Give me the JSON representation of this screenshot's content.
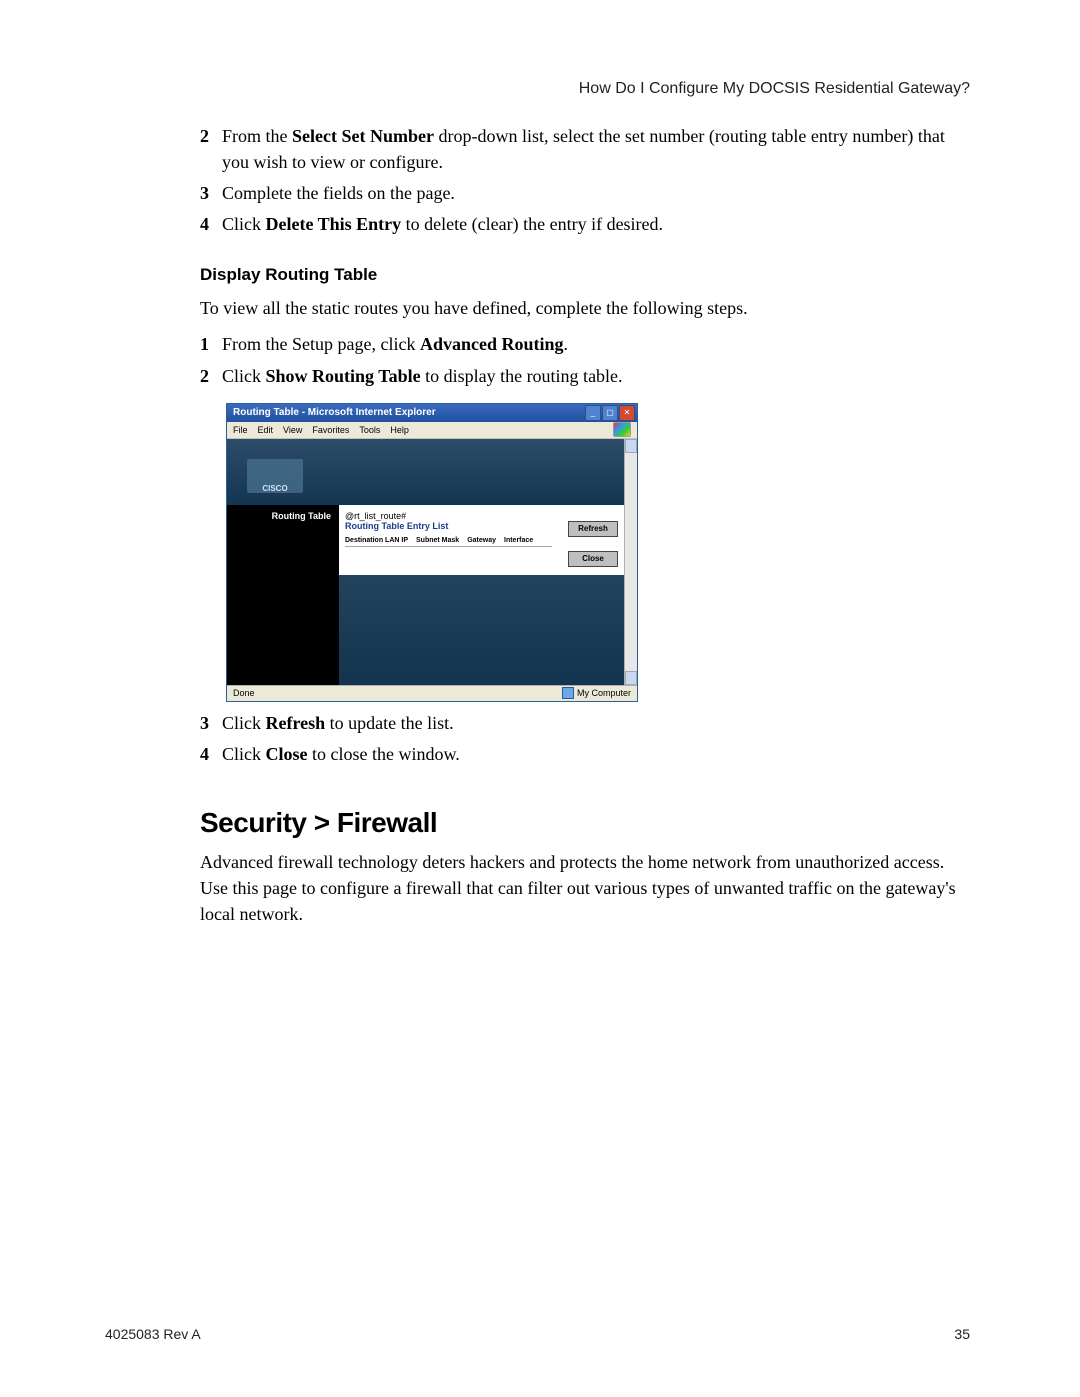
{
  "header": {
    "right_text": "How Do I Configure My DOCSIS Residential Gateway?"
  },
  "steps_a": [
    {
      "num": "2",
      "pre": "From the ",
      "bold": "Select Set Number",
      "post": " drop-down list, select the set number (routing table entry number) that you wish to view or configure."
    },
    {
      "num": "3",
      "pre": "Complete the fields on the page.",
      "bold": "",
      "post": ""
    },
    {
      "num": "4",
      "pre": "Click ",
      "bold": "Delete This Entry",
      "post": " to delete (clear) the entry if desired."
    }
  ],
  "subhead_a": "Display Routing Table",
  "intro_a": "To view all the static routes you have defined, complete the following steps.",
  "steps_b": [
    {
      "num": "1",
      "pre": "From the Setup page, click ",
      "bold": "Advanced Routing",
      "post": "."
    },
    {
      "num": "2",
      "pre": "Click ",
      "bold": "Show Routing Table",
      "post": " to display the routing table."
    }
  ],
  "ie": {
    "title": "Routing Table - Microsoft Internet Explorer",
    "menus": [
      "File",
      "Edit",
      "View",
      "Favorites",
      "Tools",
      "Help"
    ],
    "cisco": "CISCO",
    "left_label": "Routing Table",
    "cgi_text": "@rt_list_route#",
    "entry_list_title": "Routing Table Entry List",
    "col_heads": [
      "Destination LAN IP",
      "Subnet Mask",
      "Gateway",
      "Interface"
    ],
    "btn_refresh": "Refresh",
    "btn_close": "Close",
    "status_left": "Done",
    "status_right": "My Computer"
  },
  "steps_c": [
    {
      "num": "3",
      "pre": "Click ",
      "bold": "Refresh",
      "post": " to update the list."
    },
    {
      "num": "4",
      "pre": "Click ",
      "bold": "Close",
      "post": " to close the window."
    }
  ],
  "h2": "Security > Firewall",
  "firewall_para": "Advanced firewall technology deters hackers and protects the home network from unauthorized access. Use this page to configure a firewall that can filter out various types of unwanted traffic on the gateway's local network.",
  "footer": {
    "left": "4025083 Rev A",
    "right": "35"
  }
}
